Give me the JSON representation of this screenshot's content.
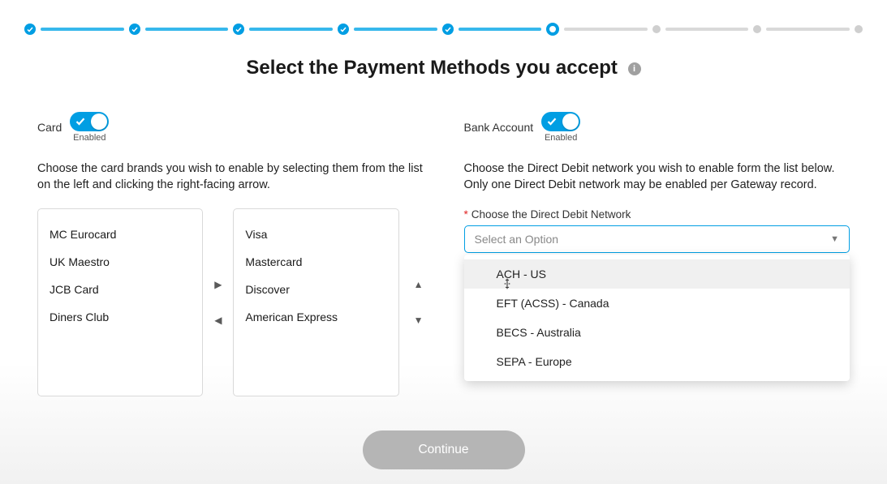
{
  "progress": {
    "steps": [
      {
        "state": "complete"
      },
      {
        "state": "complete"
      },
      {
        "state": "complete"
      },
      {
        "state": "complete"
      },
      {
        "state": "complete"
      },
      {
        "state": "current"
      },
      {
        "state": "future"
      },
      {
        "state": "future"
      },
      {
        "state": "future"
      }
    ]
  },
  "page": {
    "title": "Select the Payment Methods you accept"
  },
  "card_section": {
    "label": "Card",
    "toggle_caption": "Enabled",
    "description": "Choose the card brands you wish to enable by selecting them from the list on the left and clicking the right-facing arrow.",
    "available": [
      "MC Eurocard",
      "UK Maestro",
      "JCB Card",
      "Diners Club"
    ],
    "selected": [
      "Visa",
      "Mastercard",
      "Discover",
      "American Express"
    ]
  },
  "bank_section": {
    "label": "Bank Account",
    "toggle_caption": "Enabled",
    "description": "Choose the Direct Debit network you wish to enable form the list below. Only one Direct Debit network may be enabled per Gateway record.",
    "field_label": "Choose the Direct Debit Network",
    "placeholder": "Select an Option",
    "options": [
      "ACH - US",
      "EFT (ACSS) - Canada",
      "BECS - Australia",
      "SEPA - Europe"
    ],
    "hover_index": 0
  },
  "footer": {
    "continue_label": "Continue"
  }
}
